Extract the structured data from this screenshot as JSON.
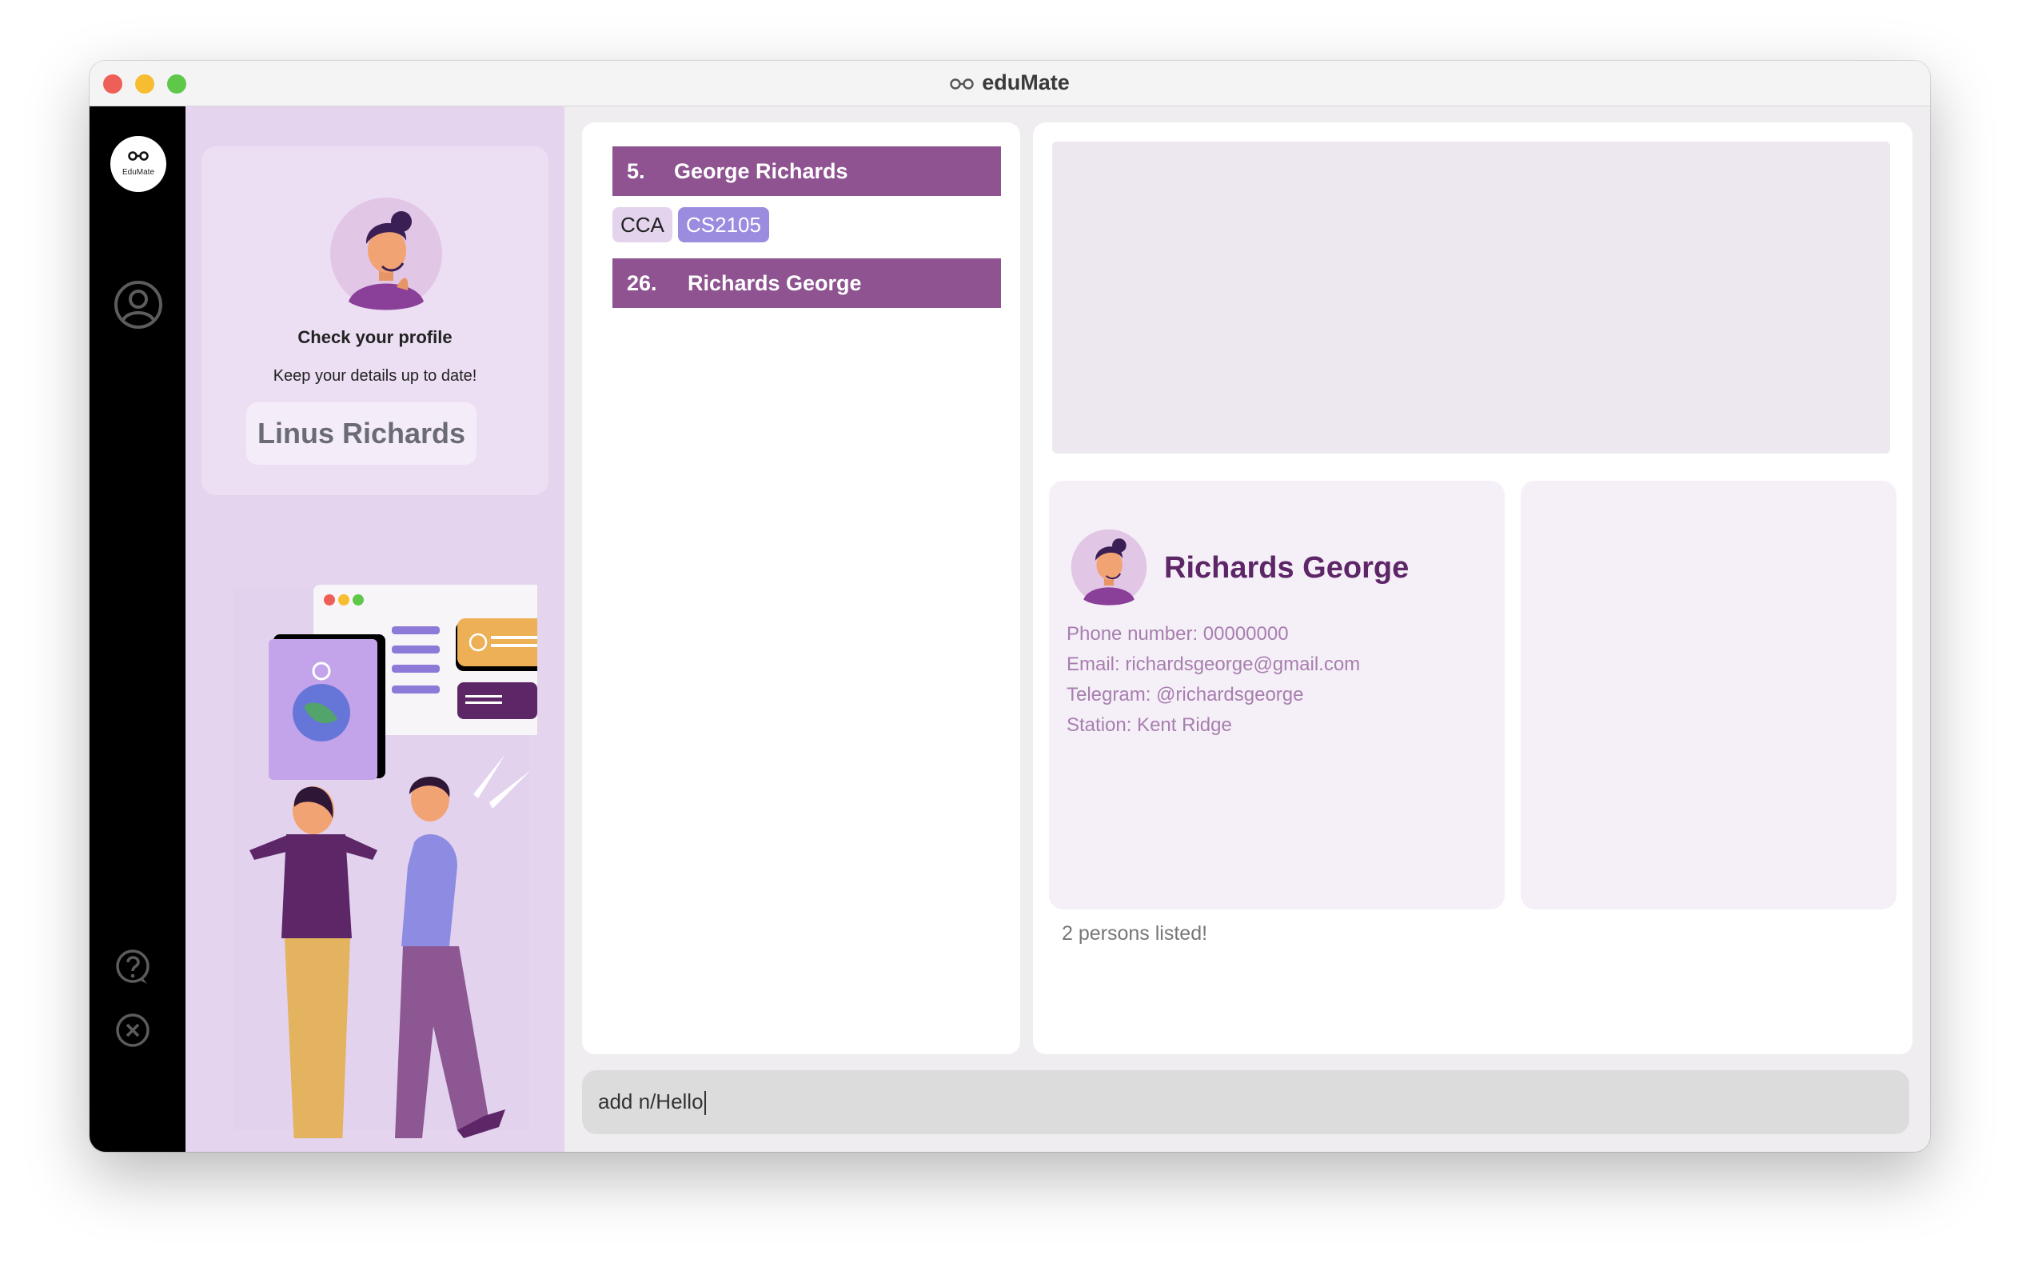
{
  "window": {
    "title": "eduMate"
  },
  "navbar": {
    "logo_text": "EduMate",
    "items": [
      "profile-icon",
      "help-icon",
      "close-icon"
    ]
  },
  "sidebar": {
    "card": {
      "heading": "Check your profile",
      "subtitle": "Keep your details up to date!",
      "user_name": "Linus Richards"
    }
  },
  "person_list": {
    "items": [
      {
        "index": "5.",
        "name": "George Richards",
        "tags": [
          "CCA",
          "CS2105"
        ]
      },
      {
        "index": "26.",
        "name": "Richards George",
        "tags": []
      }
    ]
  },
  "detail": {
    "name": "Richards George",
    "phone": "Phone number: 00000000",
    "email": "Email: richardsgeorge@gmail.com",
    "telegram": "Telegram: @richardsgeorge",
    "station": "Station: Kent Ridge",
    "status": "2 persons listed!"
  },
  "command": {
    "value": "add n/Hello"
  },
  "colors": {
    "accent": "#8e5390",
    "sidebar": "#e4d4ee",
    "tag_module": "#9b8ce0",
    "contact_name": "#5d2667"
  }
}
